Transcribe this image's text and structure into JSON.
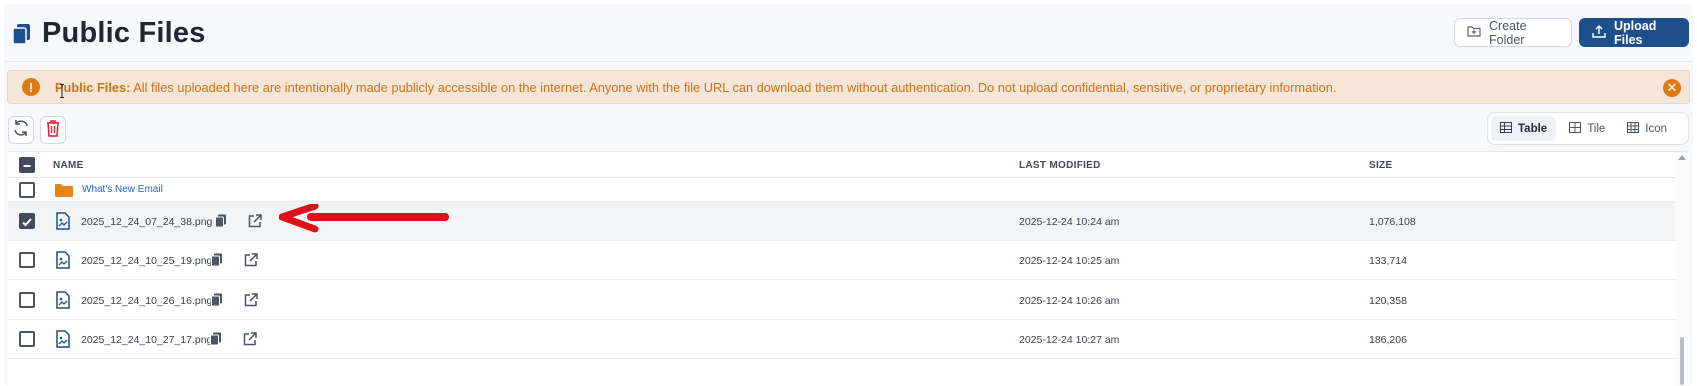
{
  "header": {
    "title": "Public Files",
    "title_icon": "copy-document-icon",
    "create_folder_label": "Create Folder",
    "upload_files_label": "Upload Files",
    "accent_color": "#1d4f8c"
  },
  "banner": {
    "strong_text": "Public Files:",
    "message": " All files uploaded here are intentionally made publicly accessible on the internet. Anyone with the file URL can download them without authentication. Do not upload confidential, sensitive, or proprietary information.",
    "icon": "warning-circle-icon",
    "close_icon": "close-circle-icon",
    "color": "#e07a10",
    "background": "#f5e6d7"
  },
  "toolbar": {
    "refresh_icon": "refresh-icon",
    "delete_icon": "trash-icon"
  },
  "view_switch": {
    "options": [
      {
        "label": "Table",
        "icon": "table-icon",
        "active": true
      },
      {
        "label": "Tile",
        "icon": "tile-grid-icon",
        "active": false
      },
      {
        "label": "Icon",
        "icon": "icon-grid-icon",
        "active": false
      }
    ]
  },
  "table": {
    "columns": {
      "name": "NAME",
      "modified": "LAST MODIFIED",
      "size": "SIZE"
    },
    "folder": {
      "name": "What's New Email",
      "checked": false
    },
    "rows": [
      {
        "name": "2025_12_24_07_24_38.png",
        "modified": "2025-12-24 10:24 am",
        "size": "1,076,108",
        "checked": true
      },
      {
        "name": "2025_12_24_10_25_19.png",
        "modified": "2025-12-24 10:25 am",
        "size": "133,714",
        "checked": false
      },
      {
        "name": "2025_12_24_10_26_16.png",
        "modified": "2025-12-24 10:26 am",
        "size": "120,358",
        "checked": false
      },
      {
        "name": "2025_12_24_10_27_17.png",
        "modified": "2025-12-24 10:27 am",
        "size": "186,206",
        "checked": false
      }
    ]
  },
  "annotation": {
    "arrow_color": "#e0101a"
  }
}
